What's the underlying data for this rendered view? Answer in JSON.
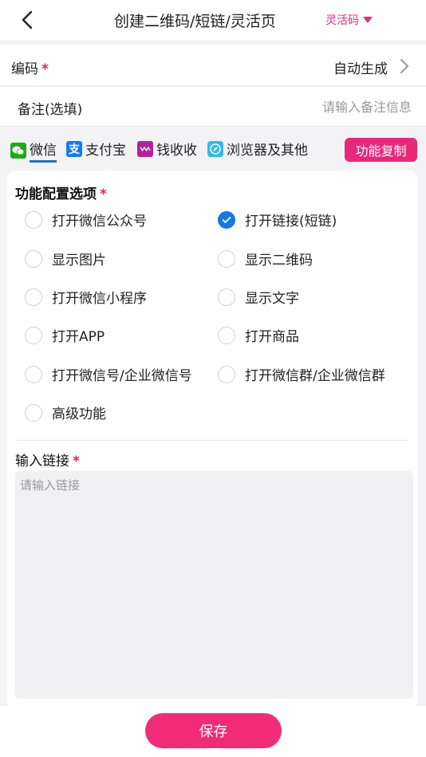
{
  "header": {
    "title": "创建二维码/短链/灵活页",
    "mode_label": "灵活码"
  },
  "code_row": {
    "label": "编码",
    "required_mark": "*",
    "value": "自动生成"
  },
  "note_row": {
    "label": "备注(选填)",
    "placeholder": "请输入备注信息"
  },
  "tabs": [
    {
      "label": "微信",
      "icon": "wechat-icon",
      "color": "#1aad19",
      "active": true
    },
    {
      "label": "支付宝",
      "icon": "alipay-icon",
      "color": "#1677ff",
      "active": false
    },
    {
      "label": "钱收收",
      "icon": "wallet-icon",
      "color": "#b0249a",
      "active": false
    },
    {
      "label": "浏览器及其他",
      "icon": "browser-icon",
      "color": "#33b8e6",
      "active": false
    }
  ],
  "copy_button": "功能复制",
  "config": {
    "title": "功能配置选项",
    "required_mark": "*",
    "options": [
      {
        "label": "打开微信公众号",
        "checked": false
      },
      {
        "label": "打开链接(短链)",
        "checked": true
      },
      {
        "label": "显示图片",
        "checked": false
      },
      {
        "label": "显示二维码",
        "checked": false
      },
      {
        "label": "打开微信小程序",
        "checked": false
      },
      {
        "label": "显示文字",
        "checked": false
      },
      {
        "label": "打开APP",
        "checked": false
      },
      {
        "label": "打开商品",
        "checked": false
      },
      {
        "label": "打开微信号/企业微信号",
        "checked": false
      },
      {
        "label": "打开微信群/企业微信群",
        "checked": false
      },
      {
        "label": "高级功能",
        "checked": false
      }
    ]
  },
  "link_input": {
    "label": "输入链接",
    "required_mark": "*",
    "placeholder": "请输入链接"
  },
  "save_button": "保存",
  "colors": {
    "accent": "#e8297a",
    "checked": "#1677e6",
    "tab_underline": "#1a73c9"
  }
}
